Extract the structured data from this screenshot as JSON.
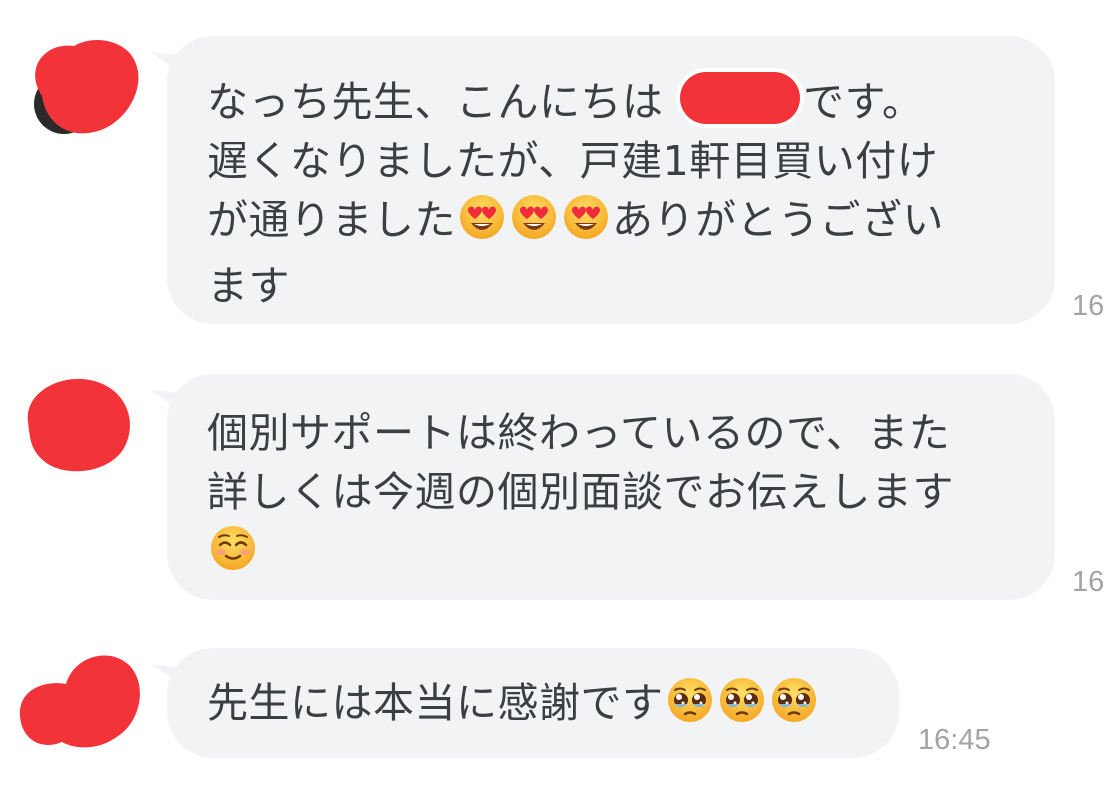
{
  "colors": {
    "bubble": "#f2f3f5",
    "text": "#3b3f44",
    "timestamp": "#a0a4a9",
    "redaction": "#f2343a"
  },
  "messages": [
    {
      "lines": [
        [
          "なっち先生、こんにちは ",
          {
            "redacted": true
          },
          "です。"
        ],
        [
          "遅くなりましたが、戸建1軒目買い付け"
        ],
        [
          "が通りました",
          {
            "emoji": "heart-eyes-face-icon"
          },
          {
            "emoji": "heart-eyes-face-icon"
          },
          {
            "emoji": "heart-eyes-face-icon"
          },
          "ありがとうござい"
        ],
        [
          "ます"
        ]
      ],
      "time": "16"
    },
    {
      "lines": [
        [
          "個別サポートは終わっているので、また"
        ],
        [
          "詳しくは今週の個別面談でお伝えします"
        ],
        [
          {
            "emoji": "smiling-blush-face-icon"
          }
        ]
      ],
      "time": "16"
    },
    {
      "lines": [
        [
          "先生には本当に感謝です",
          {
            "emoji": "pleading-face-icon"
          },
          {
            "emoji": "pleading-face-icon"
          },
          {
            "emoji": "pleading-face-icon"
          }
        ]
      ],
      "time": "16:45"
    }
  ]
}
